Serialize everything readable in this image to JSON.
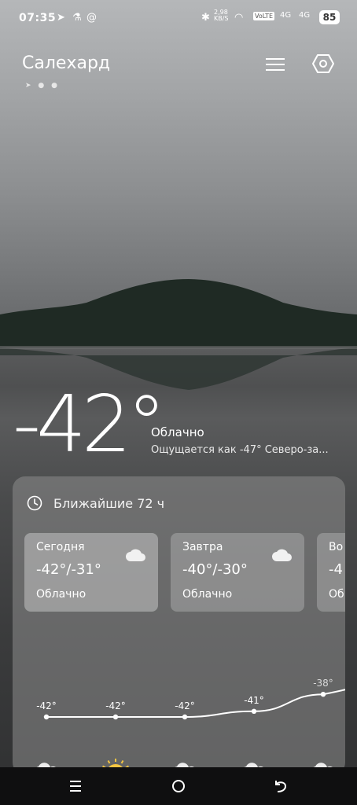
{
  "status": {
    "time": "07:35",
    "speed": "2,98 KB/S",
    "volte": "VoLTE",
    "net1": "4G",
    "net2": "4G",
    "battery": "85"
  },
  "header": {
    "city": "Салехард"
  },
  "current": {
    "temperature": "-42°",
    "condition": "Облачно",
    "feels_like": "Ощущается как -47° Северо-за..."
  },
  "forecast": {
    "title": "Ближайшие 72 ч",
    "days": [
      {
        "name": "Сегодня",
        "range": "-42°/-31°",
        "condition": "Облачно"
      },
      {
        "name": "Завтра",
        "range": "-40°/-30°",
        "condition": "Облачно"
      },
      {
        "name": "Во",
        "range": "-4",
        "condition": "Об"
      }
    ]
  },
  "chart_data": {
    "type": "line",
    "x": [
      "1",
      "2",
      "3",
      "4",
      "5"
    ],
    "values": [
      -42,
      -42,
      -42,
      -41,
      -38
    ],
    "labels": [
      "-42°",
      "-42°",
      "-42°",
      "-41°",
      "-38°"
    ],
    "icons": [
      "cloud-icon",
      "sun-icon",
      "cloud-icon",
      "cloud-icon",
      "cloud-icon"
    ]
  }
}
